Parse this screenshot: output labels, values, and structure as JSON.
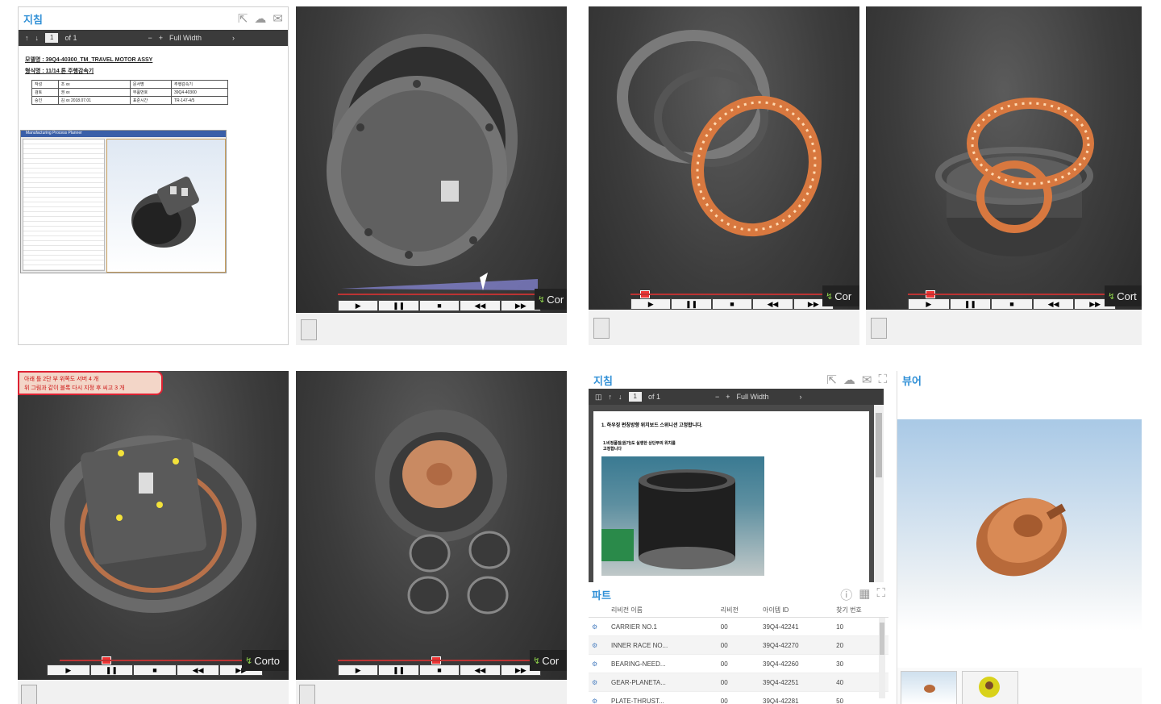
{
  "panel1": {
    "title": "지침",
    "toolbar": {
      "page_current": "1",
      "page_total": "of 1",
      "zoom_minus": "−",
      "zoom_plus": "+",
      "zoom_label": "Full Width",
      "zoom_caret": "›"
    },
    "doc_lines": [
      "모델명 : 39Q4-40300_TM_TRAVEL MOTOR ASSY",
      "형식명 : 11/14 톤 주행감속기"
    ],
    "doc_table": [
      [
        "작성",
        "조 xx",
        "문서명",
        "주행감속기"
      ],
      [
        "검토",
        "권 xx",
        "부품번호",
        "39Q4-40300"
      ],
      [
        "승인",
        "김 xx  2018.07.01",
        "표준시간",
        "TR-147-4/5"
      ]
    ],
    "screenshot_title": "Manufacturing Process Planner"
  },
  "panel_viewer_brand": "Cor",
  "panel_viewer_brand_long": "Corto",
  "panel4_brand": "Cort",
  "player_controls": [
    "▶",
    "❚❚",
    "■",
    "◀◀",
    "▶▶"
  ],
  "panel5_notice": [
    "아래 틀 2단 부 위쪽도 서버 4 개",
    "위 그림과 같이 블록 다시 지정 후 씨고 3 개"
  ],
  "panel7": {
    "title": "지침",
    "toolbar": {
      "page_current": "1",
      "page_total": "of 1",
      "zoom_minus": "−",
      "zoom_plus": "+",
      "zoom_label": "Full Width",
      "zoom_caret": "›"
    },
    "doc_lines": [
      "1. 하우징 펀칭방향 위치보드 스위니션 고정합니다.",
      "1.비정품질(원가)도 실행한 상단부의 위치를 고정합니다"
    ],
    "parts": {
      "title": "파트",
      "columns": [
        "리비전 이름",
        "리비전",
        "아이템 ID",
        "찾기 번호"
      ],
      "rows": [
        [
          "CARRIER NO.1",
          "00",
          "39Q4-42241",
          "10"
        ],
        [
          "INNER RACE NO...",
          "00",
          "39Q4-42270",
          "20"
        ],
        [
          "BEARING-NEED...",
          "00",
          "39Q4-42260",
          "30"
        ],
        [
          "GEAR-PLANETA...",
          "00",
          "39Q4-42251",
          "40"
        ],
        [
          "PLATE-THRUST...",
          "00",
          "39Q4-42281",
          "50"
        ]
      ]
    }
  },
  "panel8": {
    "title": "뷰어",
    "thumb_labels": [
      "",
      ""
    ]
  },
  "colors": {
    "accent": "#2f8fd6",
    "copper": "#d8783f",
    "dark_bg": "#3c3c3c"
  }
}
